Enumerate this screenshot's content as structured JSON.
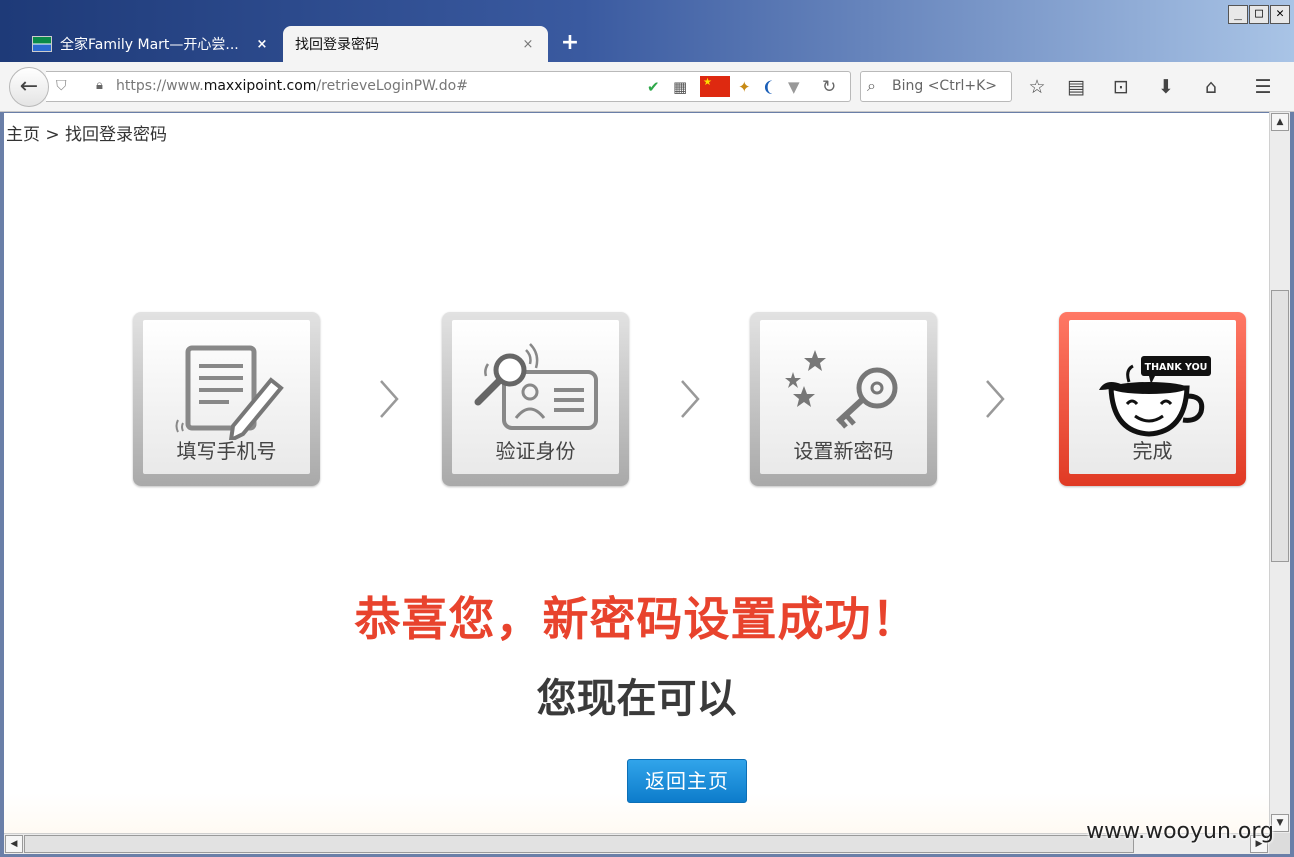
{
  "window": {
    "minimize_label": "_",
    "maximize_label": "□",
    "close_label": "✕"
  },
  "tabs": [
    {
      "title": "全家Family Mart—开心尝...",
      "close": "×"
    },
    {
      "title": "找回登录密码",
      "close": "×"
    }
  ],
  "new_tab_label": "+",
  "navbar": {
    "url_prefix": "https://www.",
    "url_domain": "maxxipoint.com",
    "url_path": "/retrieveLoginPW.do#",
    "search_placeholder": "Bing <Ctrl+K>"
  },
  "page": {
    "breadcrumb": "主页 > 找回登录密码",
    "steps": [
      {
        "label": "填写手机号"
      },
      {
        "label": "验证身份"
      },
      {
        "label": "设置新密码"
      },
      {
        "label": "完成",
        "badge": "THANK YOU"
      }
    ],
    "congrats": "恭喜您，新密码设置成功！",
    "can_now": "您现在可以",
    "home_button": "返回主页"
  },
  "watermark": "www.wooyun.org",
  "colors": {
    "accent_red": "#e8432d",
    "button_blue": "#1a8fdc"
  }
}
